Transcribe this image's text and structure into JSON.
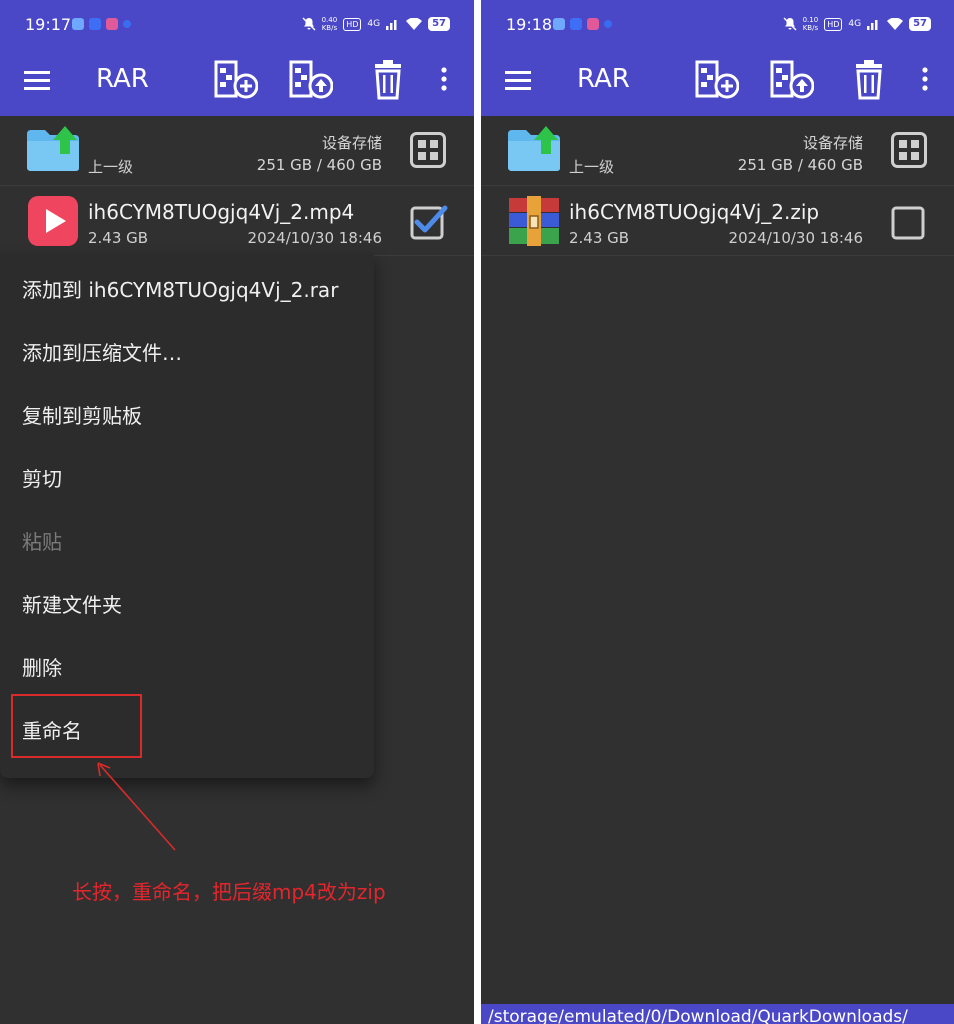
{
  "left": {
    "status": {
      "time": "19:17",
      "net_speed": "0.40",
      "net_unit": "KB/s",
      "hd": "HD",
      "signal": "4G",
      "battery": "57"
    },
    "toolbar": {
      "title": "RAR"
    },
    "parent_row": {
      "label": "上一级",
      "storage_label": "设备存储",
      "storage_size": "251 GB / 460 GB"
    },
    "file": {
      "name": "ih6CYM8TUOgjq4Vj_2.mp4",
      "size": "2.43 GB",
      "date": "2024/10/30 18:46",
      "checked": true
    },
    "context_menu": {
      "items": [
        {
          "label": "添加到 ih6CYM8TUOgjq4Vj_2.rar",
          "enabled": true
        },
        {
          "label": "添加到压缩文件…",
          "enabled": true
        },
        {
          "label": "复制到剪贴板",
          "enabled": true
        },
        {
          "label": "剪切",
          "enabled": true
        },
        {
          "label": "粘贴",
          "enabled": false
        },
        {
          "label": "新建文件夹",
          "enabled": true
        },
        {
          "label": "删除",
          "enabled": true
        },
        {
          "label": "重命名",
          "enabled": true
        }
      ]
    },
    "annotation": "长按，重命名，把后缀mp4改为zip"
  },
  "right": {
    "status": {
      "time": "19:18",
      "net_speed": "0.10",
      "net_unit": "KB/s",
      "hd": "HD",
      "signal": "4G",
      "battery": "57"
    },
    "toolbar": {
      "title": "RAR"
    },
    "parent_row": {
      "label": "上一级",
      "storage_label": "设备存储",
      "storage_size": "251 GB / 460 GB"
    },
    "file": {
      "name": "ih6CYM8TUOgjq4Vj_2.zip",
      "size": "2.43 GB",
      "date": "2024/10/30 18:46",
      "checked": false
    },
    "path": "/storage/emulated/0/Download/QuarkDownloads/"
  },
  "colors": {
    "toolbar": "#4a48c6",
    "background": "#303030",
    "accent_check": "#4d8be8",
    "annotation": "#e4262c"
  },
  "icons": [
    "menu-icon",
    "add-to-archive-icon",
    "extract-icon",
    "trash-icon",
    "more-vert-icon",
    "folder-up-icon",
    "grid-icon",
    "video-file-icon",
    "rar-archive-icon",
    "checkbox-checked-icon",
    "checkbox-empty-icon"
  ]
}
